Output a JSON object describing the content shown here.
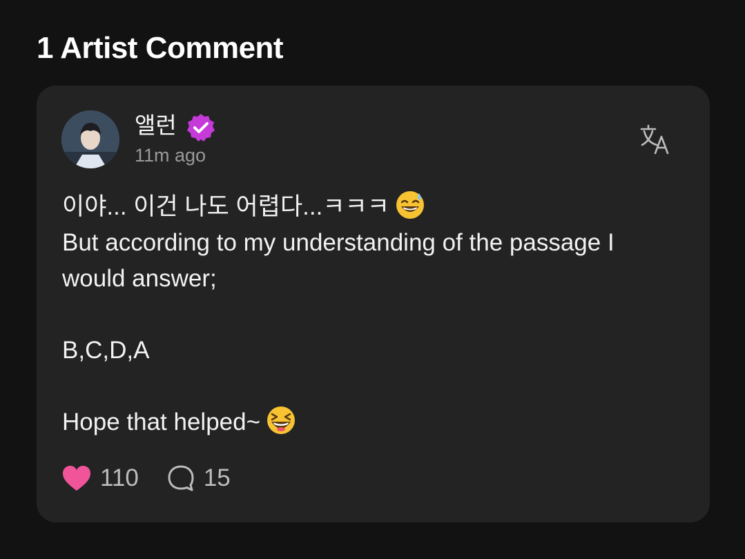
{
  "section": {
    "title": "1 Artist Comment"
  },
  "comment": {
    "author": "앨런",
    "verified": true,
    "timestamp": "11m ago",
    "lines": [
      "이야... 이건 나도 어렵다...ㅋㅋㅋ",
      "But according to my understanding of the passage I would answer;",
      "B,C,D,A",
      "Hope that helped~"
    ],
    "emoji": [
      "sweat-smile-emoji",
      "laughing-emoji"
    ],
    "likes": "110",
    "replies": "15"
  },
  "icons": {
    "translate": "translate-icon",
    "like": "heart-icon",
    "reply": "comment-bubble-icon"
  },
  "colors": {
    "background": "#121212",
    "card": "#232323",
    "verified_badge": "#c53ad9",
    "heart": "#f0559a",
    "muted_text": "#9a9a9a"
  }
}
